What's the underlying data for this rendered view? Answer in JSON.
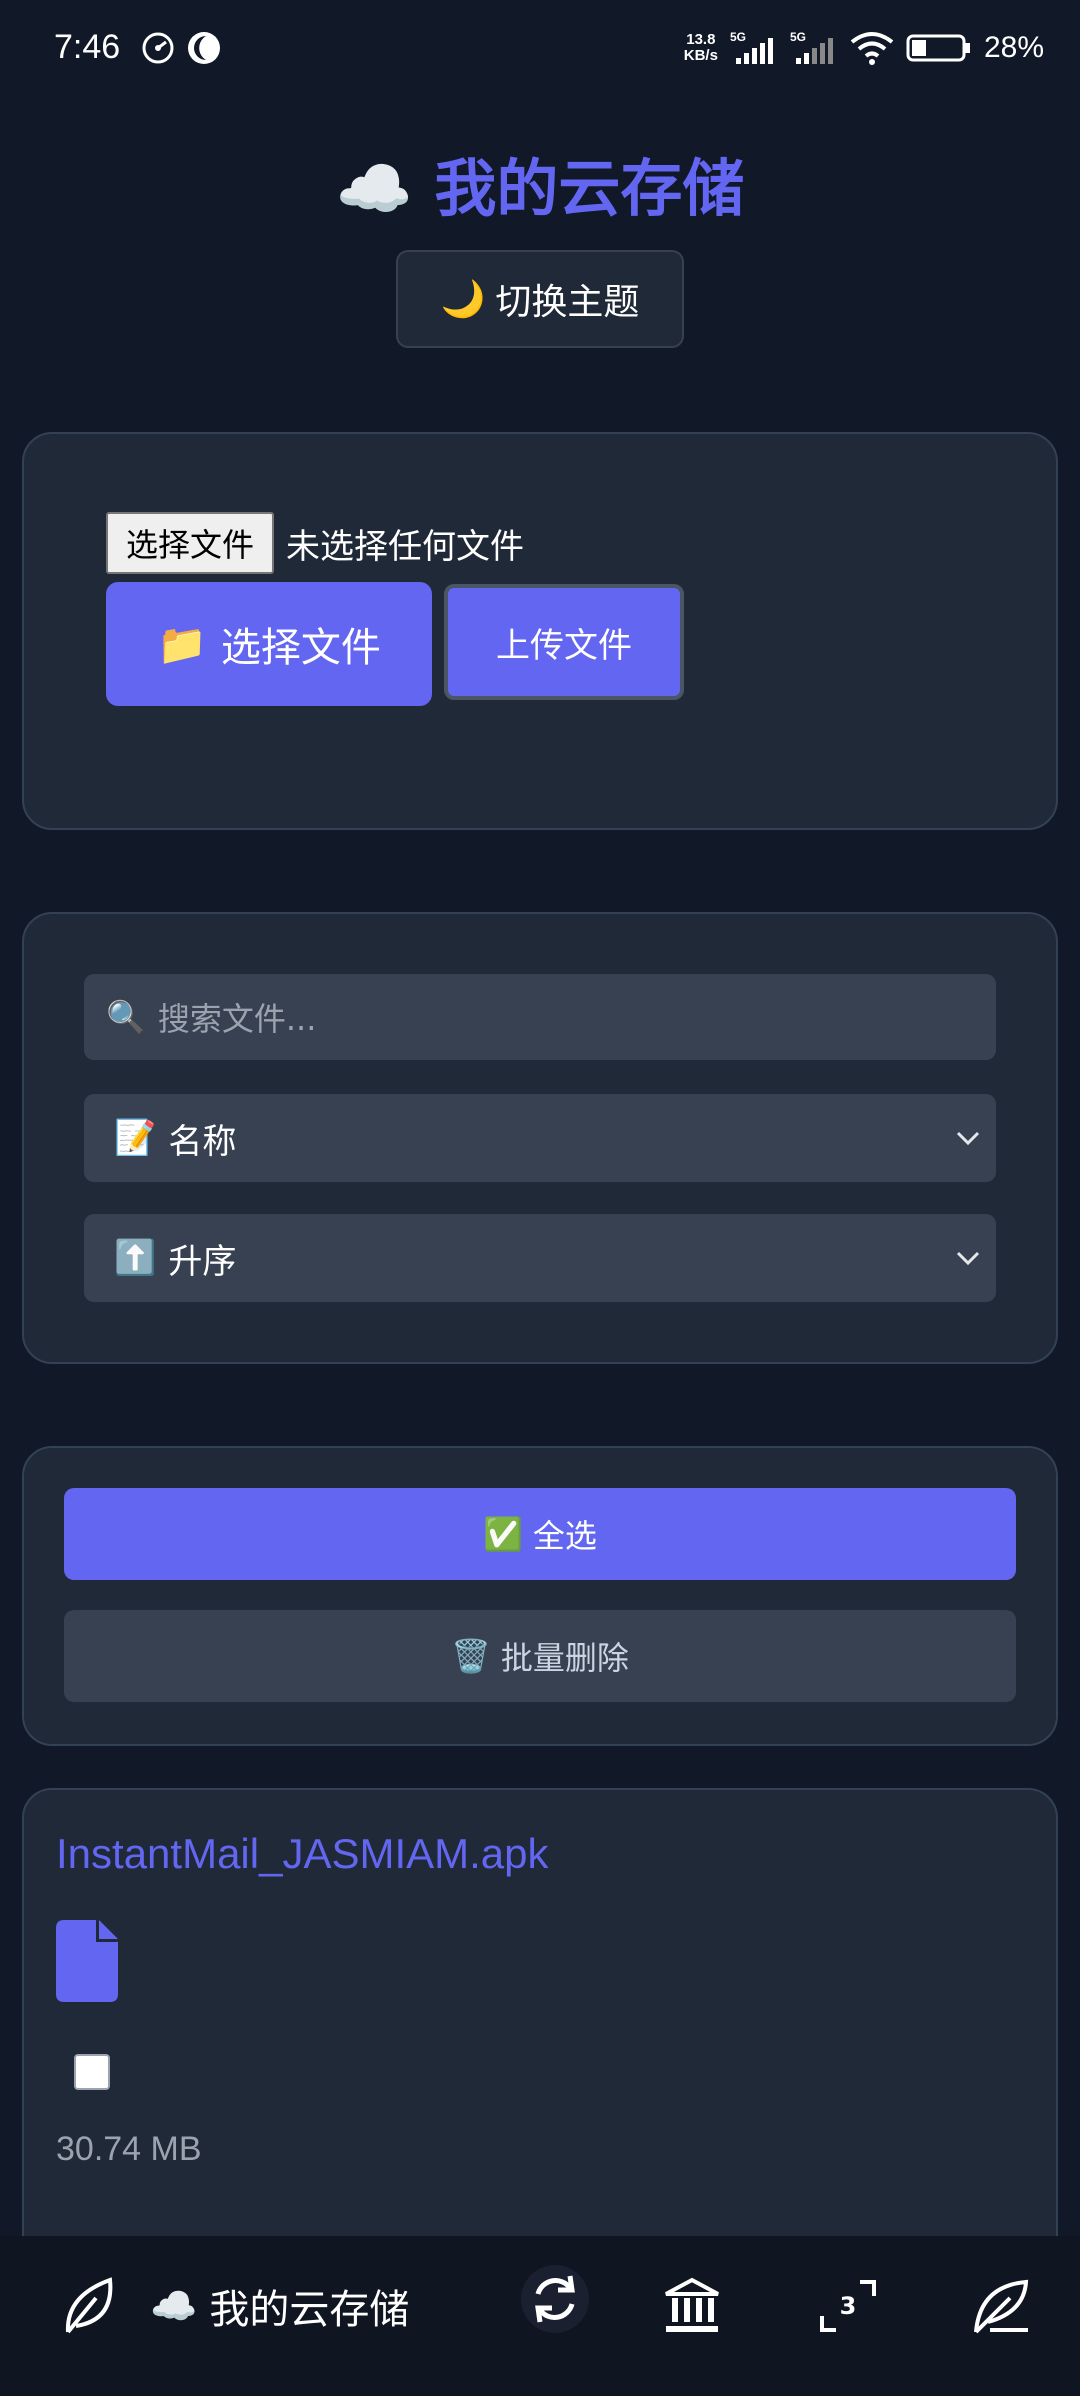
{
  "status": {
    "time": "7:46",
    "net_speed_value": "13.8",
    "net_speed_unit": "KB/s",
    "battery": "28%",
    "icons": [
      "speedometer-icon",
      "moon-app-icon",
      "signal-5g-icon",
      "signal-5g-icon",
      "wifi-icon",
      "battery-icon"
    ]
  },
  "header": {
    "cloud": "☁️",
    "title": "我的云存储",
    "theme_icon": "🌙",
    "theme_label": "切换主题"
  },
  "upload": {
    "native_button": "选择文件",
    "no_file": "未选择任何文件",
    "pick_icon": "📁",
    "pick_label": "选择文件",
    "upload_label": "上传文件"
  },
  "filters": {
    "search_icon": "🔍",
    "search_placeholder": "搜索文件...",
    "sort_field_icon": "📝",
    "sort_field": "名称",
    "sort_order_icon": "⬆️",
    "sort_order": "升序"
  },
  "actions": {
    "select_all_icon": "✅",
    "select_all": "全选",
    "batch_delete_icon": "🗑️",
    "batch_delete": "批量删除"
  },
  "files": [
    {
      "name": "InstantMail_JASMIAM.apk",
      "size": "30.74 MB",
      "checked": false
    }
  ],
  "bottom_nav": {
    "cloud": "☁️",
    "title": "我的云存储",
    "tab_count": "3",
    "icons": [
      "leaf-icon",
      "reload-icon",
      "bank-icon",
      "tabs-icon",
      "feather-icon"
    ]
  },
  "colors": {
    "accent": "#6366f1",
    "background": "#111827",
    "card": "#1f2937",
    "input": "#374151"
  }
}
